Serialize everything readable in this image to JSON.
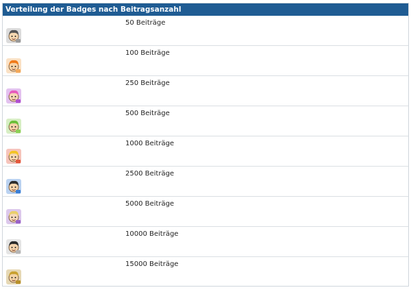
{
  "table": {
    "title": "Verteilung der Badges nach Beitragsanzahl",
    "rows": [
      {
        "label": "50 Beiträge",
        "icon": "badge-avatar-gray-icon",
        "hair": "#555555",
        "skin": "#f5d7b0",
        "accent": "#9a9a9a"
      },
      {
        "label": "100 Beiträge",
        "icon": "badge-avatar-orange-icon",
        "hair": "#f07a1a",
        "skin": "#f7d2a6",
        "accent": "#f2a85a"
      },
      {
        "label": "250 Beiträge",
        "icon": "badge-avatar-pink-icon",
        "hair": "#e65bbd",
        "skin": "#f5d5b5",
        "accent": "#b04fd0"
      },
      {
        "label": "500 Beiträge",
        "icon": "badge-avatar-green-icon",
        "hair": "#6cbf3a",
        "skin": "#f3d2a8",
        "accent": "#8ccf55"
      },
      {
        "label": "1000 Beiträge",
        "icon": "badge-avatar-yellow-icon",
        "hair": "#f3c425",
        "skin": "#f6d6ae",
        "accent": "#e4573b"
      },
      {
        "label": "2500 Beiträge",
        "icon": "badge-avatar-blue-icon",
        "hair": "#2d2d2d",
        "skin": "#f4d3ab",
        "accent": "#3a7fd6"
      },
      {
        "label": "5000 Beiträge",
        "icon": "badge-avatar-purple-icon",
        "hair": "#e9cf6a",
        "skin": "#f5d8b8",
        "accent": "#9a62c8"
      },
      {
        "label": "10000 Beiträge",
        "icon": "badge-avatar-silver-icon",
        "hair": "#2a2a2a",
        "skin": "#f1d1ab",
        "accent": "#b5b5b5"
      },
      {
        "label": "15000 Beiträge",
        "icon": "badge-avatar-gold-icon",
        "hair": "#c9a130",
        "skin": "#f2d2a5",
        "accent": "#b8902a"
      }
    ]
  }
}
